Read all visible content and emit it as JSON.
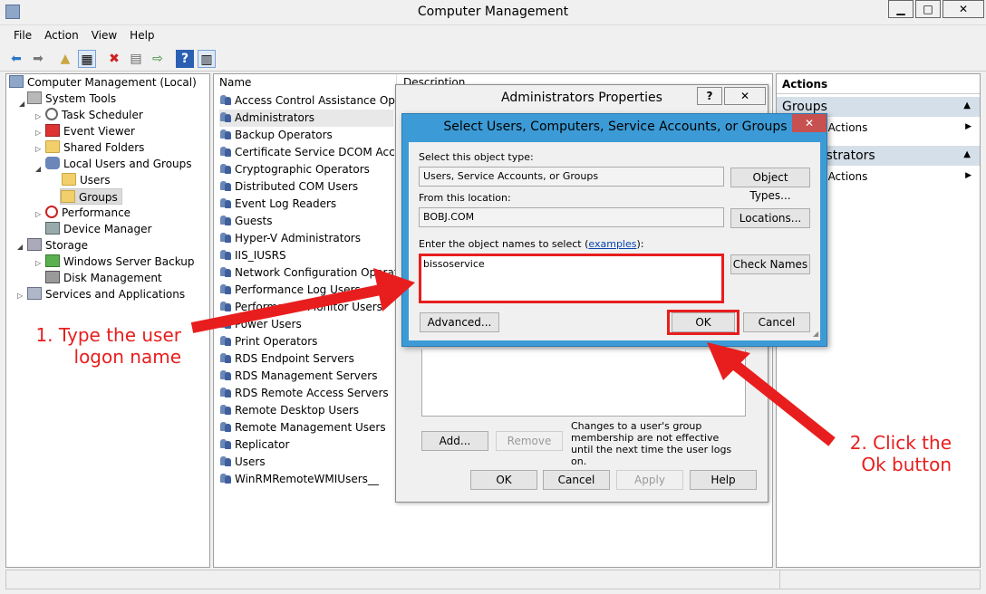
{
  "window": {
    "title": "Computer Management",
    "min": "▁",
    "max": "□",
    "close": "✕"
  },
  "menu": [
    "File",
    "Action",
    "View",
    "Help"
  ],
  "tree": {
    "root": "Computer Management (Local)",
    "system_tools": "System Tools",
    "task_scheduler": "Task Scheduler",
    "event_viewer": "Event Viewer",
    "shared_folders": "Shared Folders",
    "local_users_groups": "Local Users and Groups",
    "users": "Users",
    "groups": "Groups",
    "performance": "Performance",
    "device_manager": "Device Manager",
    "storage": "Storage",
    "wsb": "Windows Server Backup",
    "disk_mgmt": "Disk Management",
    "services_apps": "Services and Applications"
  },
  "list": {
    "col_name": "Name",
    "col_desc": "Description",
    "items": [
      "Access Control Assistance Oper...",
      "Administrators",
      "Backup Operators",
      "Certificate Service DCOM Access",
      "Cryptographic Operators",
      "Distributed COM Users",
      "Event Log Readers",
      "Guests",
      "Hyper-V Administrators",
      "IIS_IUSRS",
      "Network Configuration Operators",
      "Performance Log Users",
      "Performance Monitor Users",
      "Power Users",
      "Print Operators",
      "RDS Endpoint Servers",
      "RDS Management Servers",
      "RDS Remote Access Servers",
      "Remote Desktop Users",
      "Remote Management Users",
      "Replicator",
      "Users",
      "WinRMRemoteWMIUsers__"
    ]
  },
  "actions": {
    "header": "Actions",
    "section1": "Groups",
    "more1": "More Actions",
    "section2": "Administrators",
    "more2": "More Actions"
  },
  "admin_props": {
    "title": "Administrators Properties",
    "help": "?",
    "close": "✕",
    "note": "Changes to a user's group membership are not effective until the next time the user logs on.",
    "add": "Add...",
    "remove": "Remove",
    "ok": "OK",
    "cancel": "Cancel",
    "apply": "Apply",
    "help_btn": "Help"
  },
  "select_dialog": {
    "title": "Select Users, Computers, Service Accounts, or Groups",
    "close": "✕",
    "type_label": "Select this object type:",
    "type_value": "Users, Service Accounts, or Groups",
    "object_types_btn": "Object Types...",
    "location_label": "From this location:",
    "location_value": "BOBJ.COM",
    "locations_btn": "Locations...",
    "names_label_prefix": "Enter the object names to select (",
    "names_label_link": "examples",
    "names_label_suffix": "):",
    "names_value": "bissoservice",
    "check_names_btn": "Check Names",
    "advanced_btn": "Advanced...",
    "ok_btn": "OK",
    "cancel_btn": "Cancel"
  },
  "annotations": {
    "step1_line1": "1. Type the user",
    "step1_line2": "logon name",
    "step2_line1": "2. Click the",
    "step2_line2": "Ok button"
  },
  "colors": {
    "accent": "#3c9bd6",
    "annotation": "#e81e1e"
  }
}
